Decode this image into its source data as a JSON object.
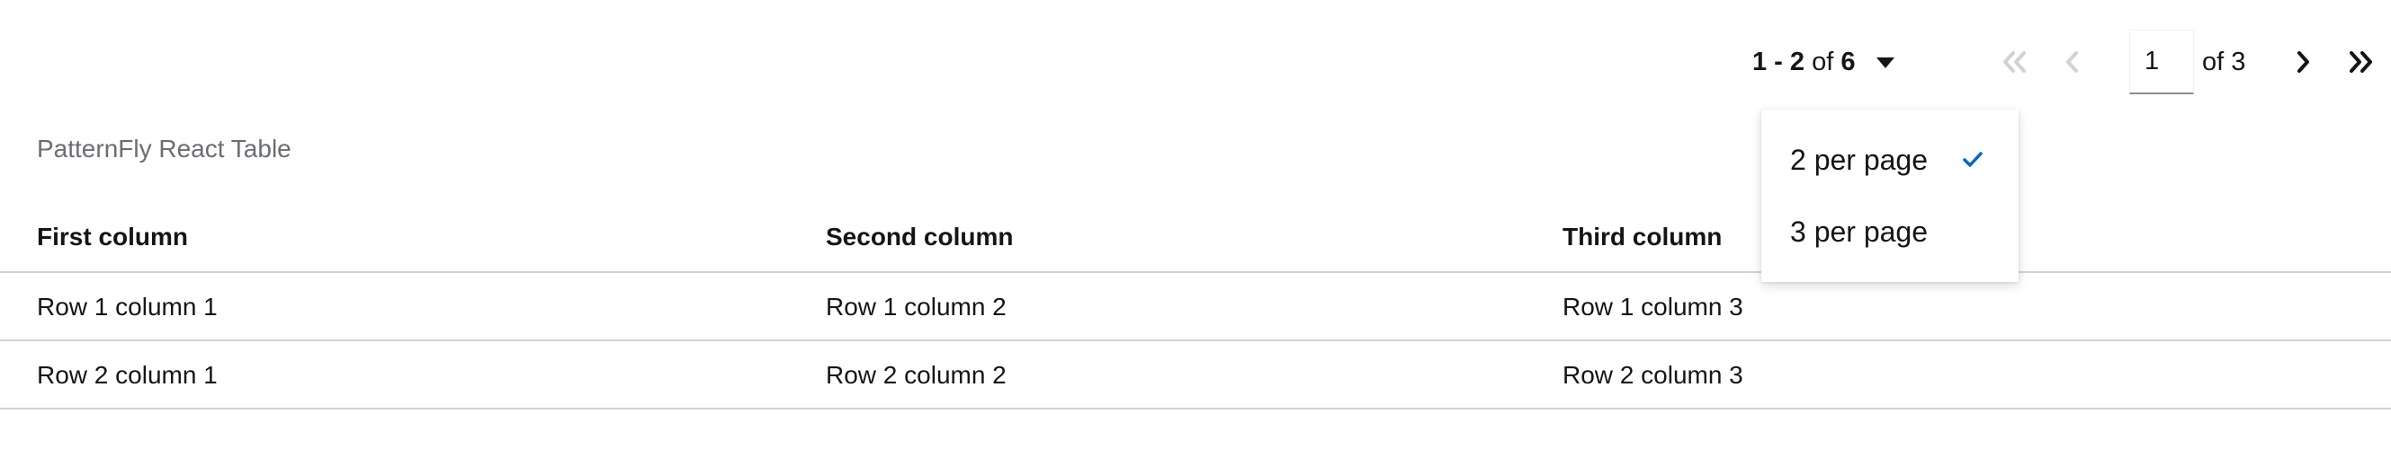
{
  "pagination": {
    "range": "1 - 2",
    "of_label": "of",
    "total": "6",
    "current_page": "1",
    "total_pages_label": "of 3",
    "buttons": [
      "first-page",
      "previous-page",
      "next-page",
      "last-page"
    ]
  },
  "per_page_menu": {
    "options": [
      {
        "label": "2 per page",
        "selected": true
      },
      {
        "label": "3 per page",
        "selected": false
      }
    ]
  },
  "table": {
    "caption": "PatternFly React Table",
    "columns": [
      "First column",
      "Second column",
      "Third column"
    ],
    "rows": [
      [
        "Row 1 column 1",
        "Row 1 column 2",
        "Row 1 column 3"
      ],
      [
        "Row 2 column 1",
        "Row 2 column 2",
        "Row 2 column 3"
      ]
    ]
  },
  "colors": {
    "text": "#151515",
    "muted": "#6a6e73",
    "disabled": "#d2d2d2",
    "accent": "#0066cc",
    "border": "#d2d2d2"
  },
  "icons": {
    "toggle": "caret-down-icon",
    "first": "angle-double-left-icon",
    "prev": "angle-left-icon",
    "next": "angle-right-icon",
    "last": "angle-double-right-icon",
    "selected": "check-icon"
  }
}
